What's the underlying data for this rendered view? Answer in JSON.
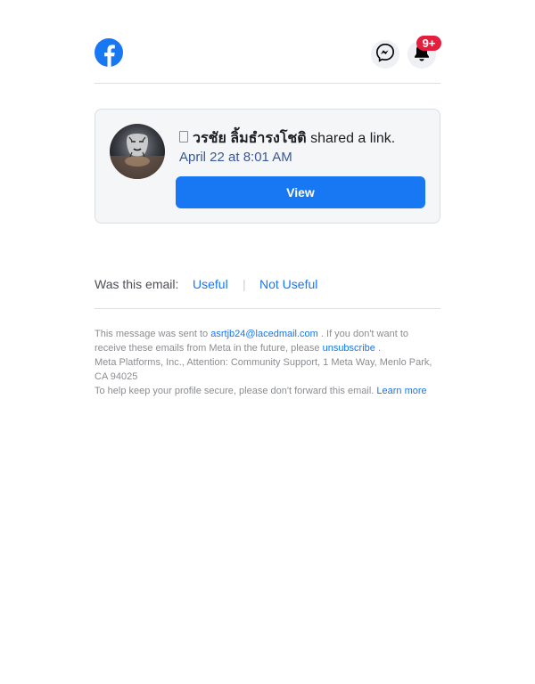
{
  "header": {
    "logo_icon": "facebook-logo-icon",
    "messenger_icon": "messenger-icon",
    "notifications_icon": "bell-icon",
    "notifications_badge": "9+",
    "brand_color": "#1877f2",
    "badge_color": "#e41e3f"
  },
  "notification": {
    "actor_name": "วรชัย ลิ้มธำรงโชติ",
    "action_text": "shared a link.",
    "timestamp": "April 22 at 8:01 AM",
    "view_button_label": "View"
  },
  "feedback": {
    "question": "Was this email:",
    "useful_label": "Useful",
    "separator": "|",
    "not_useful_label": "Not Useful"
  },
  "footer": {
    "sent_prefix": "This message was sent to",
    "email": "asrtjb24@lacedmail.com",
    "sent_suffix": ". If you don't want to receive these emails from Meta in the future, please",
    "unsubscribe_label": "unsubscribe",
    "unsubscribe_suffix": ".",
    "address": "Meta Platforms, Inc., Attention: Community Support, 1 Meta Way, Menlo Park, CA 94025",
    "secure_text": "To help keep your profile secure, please don't forward this email.",
    "learn_more_label": "Learn more"
  }
}
